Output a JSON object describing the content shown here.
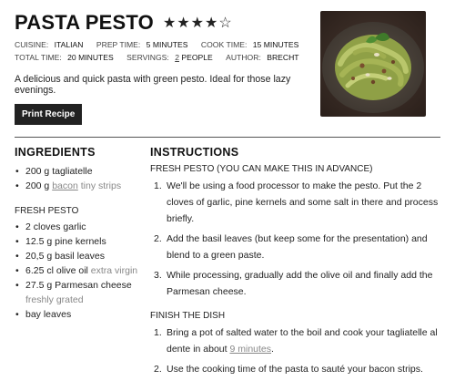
{
  "recipe": {
    "title": "PASTA PESTO",
    "rating_stars": "★★★★☆",
    "meta": {
      "cuisine_label": "CUISINE:",
      "cuisine": "ITALIAN",
      "prep_label": "PREP TIME:",
      "prep": "5 MINUTES",
      "cook_label": "COOK TIME:",
      "cook": "15 MINUTES",
      "total_label": "TOTAL TIME:",
      "total": "20 MINUTES",
      "servings_label": "SERVINGS:",
      "servings_count": "2",
      "servings_unit": "PEOPLE",
      "author_label": "AUTHOR:",
      "author": "BRECHT"
    },
    "description": "A delicious and quick pasta with green pesto. Ideal for those lazy evenings.",
    "print_label": "Print Recipe"
  },
  "ingredients": {
    "heading": "INGREDIENTS",
    "group1": [
      {
        "text": "200 g tagliatelle"
      },
      {
        "pre": "200 g ",
        "link": "bacon",
        "note": " tiny strips"
      }
    ],
    "group2_title": "FRESH PESTO",
    "group2": [
      {
        "text": "2 cloves garlic"
      },
      {
        "text": "12.5 g pine kernels"
      },
      {
        "text": "20,5 g basil leaves"
      },
      {
        "text": "6.25 cl olive oil",
        "note": " extra virgin"
      },
      {
        "text": "27.5 g Parmesan cheese",
        "note": " freshly grated"
      },
      {
        "text": "bay leaves"
      }
    ]
  },
  "instructions": {
    "heading": "INSTRUCTIONS",
    "section1_title": "FRESH PESTO (YOU CAN MAKE THIS IN ADVANCE)",
    "section1": [
      "We'll be using a food processor to make the pesto. Put the 2 cloves of garlic, pine kernels and some salt in there and process briefly.",
      "Add the basil leaves (but keep some for the presentation) and blend to a green paste.",
      "While processing, gradually add the olive oil and finally add the Parmesan cheese."
    ],
    "section2_title": "FINISH THE DISH",
    "section2_step1_pre": "Bring a pot of salted water to the boil and cook your tagliatelle al dente in about ",
    "section2_step1_link": "9 minutes",
    "section2_step1_post": ".",
    "section2_step2": "Use the cooking time of the pasta to sauté your bacon strips."
  },
  "icons": {
    "photo": "pasta-pesto-photo"
  }
}
